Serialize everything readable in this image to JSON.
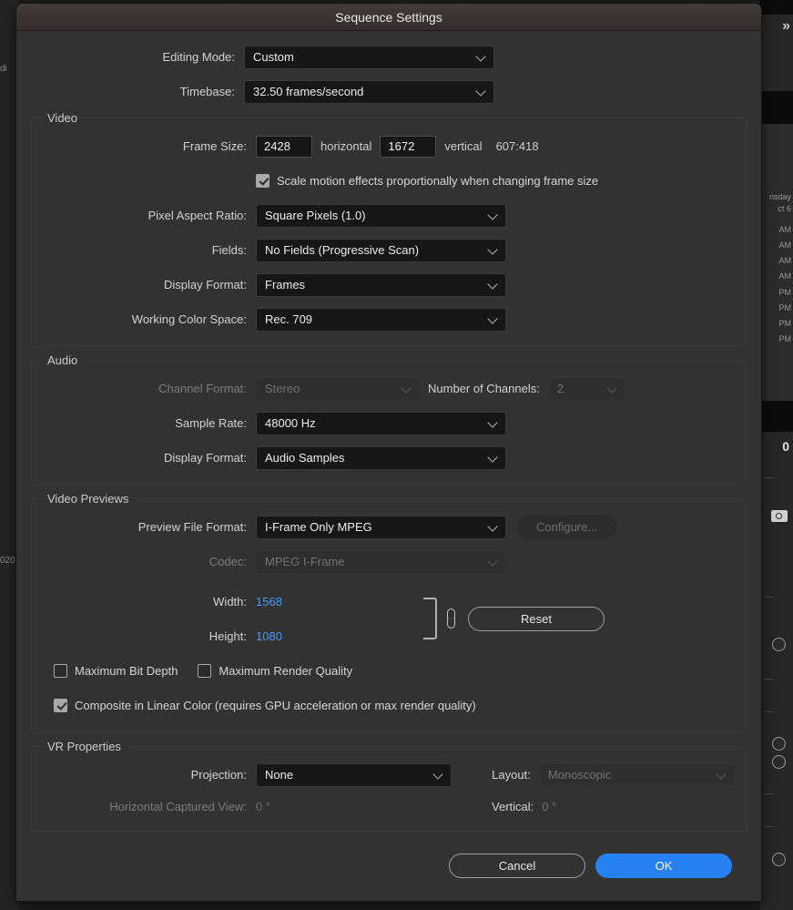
{
  "window": {
    "title": "Sequence Settings"
  },
  "top": {
    "editing_mode_label": "Editing Mode:",
    "editing_mode_value": "Custom",
    "timebase_label": "Timebase:",
    "timebase_value": "32.50  frames/second"
  },
  "video": {
    "legend": "Video",
    "frame_size_label": "Frame Size:",
    "frame_size_horizontal": "2428",
    "horizontal_word": "horizontal",
    "frame_size_vertical": "1672",
    "vertical_word": "vertical",
    "aspect_ratio": "607:418",
    "scale_motion_label": "Scale motion effects proportionally when changing frame size",
    "scale_motion_checked": true,
    "pixel_aspect_label": "Pixel Aspect Ratio:",
    "pixel_aspect_value": "Square Pixels (1.0)",
    "fields_label": "Fields:",
    "fields_value": "No Fields (Progressive Scan)",
    "display_format_label": "Display Format:",
    "display_format_value": "Frames",
    "working_color_space_label": "Working Color Space:",
    "working_color_space_value": "Rec. 709"
  },
  "audio": {
    "legend": "Audio",
    "channel_format_label": "Channel Format:",
    "channel_format_value": "Stereo",
    "number_of_channels_label": "Number of Channels:",
    "number_of_channels_value": "2",
    "sample_rate_label": "Sample Rate:",
    "sample_rate_value": "48000 Hz",
    "display_format_label": "Display Format:",
    "display_format_value": "Audio Samples"
  },
  "video_previews": {
    "legend": "Video Previews",
    "preview_file_format_label": "Preview File Format:",
    "preview_file_format_value": "I-Frame Only MPEG",
    "configure_button": "Configure...",
    "codec_label": "Codec:",
    "codec_value": "MPEG I-Frame",
    "width_label": "Width:",
    "width_value": "1568",
    "height_label": "Height:",
    "height_value": "1080",
    "reset_button": "Reset",
    "max_bit_depth_label": "Maximum Bit Depth",
    "max_bit_depth_checked": false,
    "max_render_quality_label": "Maximum Render Quality",
    "max_render_quality_checked": false,
    "composite_linear_label": "Composite in Linear Color (requires GPU acceleration or max render quality)",
    "composite_linear_checked": true
  },
  "vr": {
    "legend": "VR Properties",
    "projection_label": "Projection:",
    "projection_value": "None",
    "layout_label": "Layout:",
    "layout_value": "Monoscopic",
    "horizontal_view_label": "Horizontal Captured View:",
    "horizontal_view_value": "0 °",
    "vertical_label": "Vertical:",
    "vertical_value": "0 °"
  },
  "footer": {
    "cancel_label": "Cancel",
    "ok_label": "OK"
  },
  "backdrop": {
    "expand_chevron": "»",
    "left_fragment_1": "di",
    "left_fragment_2": "020",
    "right_day": "nsday",
    "right_date": "ct 6",
    "right_times": [
      "AM",
      "AM",
      "AM",
      "AM",
      "PM",
      "PM",
      "PM",
      "PM"
    ],
    "right_num": "0"
  },
  "colors": {
    "accent": "#2681f2",
    "value_blue": "#4a9bf5",
    "dialog_bg": "#323232",
    "field_bg": "#161616"
  }
}
